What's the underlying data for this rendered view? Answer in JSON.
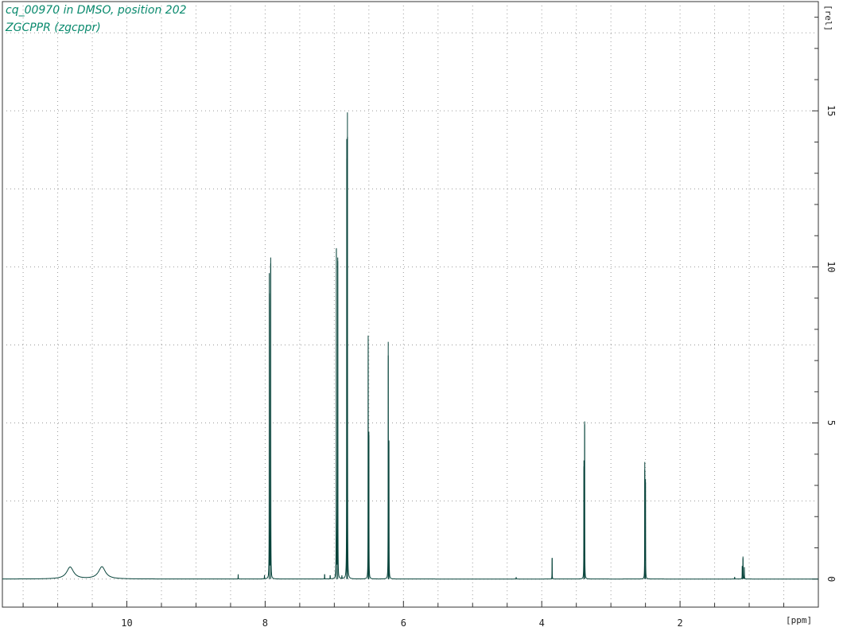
{
  "header": {
    "line1": "cq_00970 in DMSO, position 202",
    "line2": "ZGCPPR (zgcppr)"
  },
  "colors": {
    "spectrum": "#06433a",
    "title": "#0a8a6e",
    "grid": "#9a9a9a",
    "axis": "#333333"
  },
  "chart_data": {
    "type": "line",
    "title": "",
    "xlabel": "[ppm]",
    "ylabel": "[rel]",
    "x_axis_reversed": true,
    "xlim": [
      11.8,
      0.0
    ],
    "ylim": [
      -0.9,
      18.5
    ],
    "x_ticks": [
      10,
      8,
      6,
      4,
      2
    ],
    "y_ticks": [
      0,
      5,
      10,
      15
    ],
    "grid": true,
    "series": [
      {
        "baseline": 0,
        "peaks": [
          {
            "ppm": 10.82,
            "height": 0.38,
            "width": 0.06,
            "shape": "broad"
          },
          {
            "ppm": 10.36,
            "height": 0.39,
            "width": 0.06,
            "shape": "broad"
          },
          {
            "ppm": 8.39,
            "height": 0.15,
            "shape": "sharp"
          },
          {
            "ppm": 8.01,
            "height": 0.12,
            "shape": "sharp"
          },
          {
            "ppm": 7.94,
            "height": 9.8,
            "shape": "sharp"
          },
          {
            "ppm": 7.92,
            "height": 10.3,
            "shape": "sharp"
          },
          {
            "ppm": 7.14,
            "height": 0.15,
            "shape": "sharp"
          },
          {
            "ppm": 7.06,
            "height": 0.12,
            "shape": "sharp"
          },
          {
            "ppm": 6.97,
            "height": 10.6,
            "shape": "sharp"
          },
          {
            "ppm": 6.95,
            "height": 10.3,
            "shape": "sharp"
          },
          {
            "ppm": 6.89,
            "height": 0.1,
            "shape": "sharp"
          },
          {
            "ppm": 6.82,
            "height": 14.1,
            "shape": "sharp"
          },
          {
            "ppm": 6.81,
            "height": 14.95,
            "shape": "sharp"
          },
          {
            "ppm": 6.51,
            "height": 7.8,
            "shape": "sharp"
          },
          {
            "ppm": 6.5,
            "height": 4.6,
            "shape": "sharp"
          },
          {
            "ppm": 6.22,
            "height": 7.6,
            "shape": "sharp"
          },
          {
            "ppm": 6.21,
            "height": 4.4,
            "shape": "sharp"
          },
          {
            "ppm": 4.37,
            "height": 0.06,
            "shape": "sharp"
          },
          {
            "ppm": 3.85,
            "height": 0.68,
            "shape": "sharp"
          },
          {
            "ppm": 3.39,
            "height": 3.8,
            "shape": "sharp"
          },
          {
            "ppm": 3.38,
            "height": 5.05,
            "shape": "sharp"
          },
          {
            "ppm": 2.51,
            "height": 3.75,
            "shape": "sharp"
          },
          {
            "ppm": 2.5,
            "height": 3.2,
            "shape": "sharp"
          },
          {
            "ppm": 1.1,
            "height": 0.42,
            "shape": "sharp"
          },
          {
            "ppm": 1.09,
            "height": 0.72,
            "shape": "sharp"
          },
          {
            "ppm": 1.07,
            "height": 0.38,
            "shape": "sharp"
          },
          {
            "ppm": 1.21,
            "height": 0.06,
            "shape": "sharp"
          }
        ]
      }
    ]
  }
}
